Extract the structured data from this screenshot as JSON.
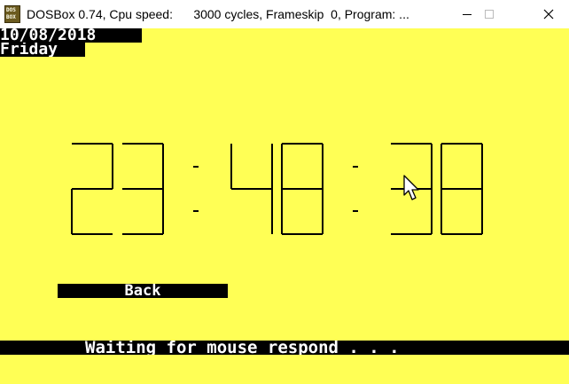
{
  "window": {
    "title": "DOSBox 0.74, Cpu speed:      3000 cycles, Frameskip  0, Program: ...",
    "icon_label_top": "DOS",
    "icon_label_bottom": "BOX"
  },
  "screen": {
    "date": "10/08/2018",
    "day": "Friday",
    "clock": {
      "hours": "23",
      "minutes": "48",
      "seconds": "38"
    },
    "back_label": "Back",
    "status": "Waiting for mouse respond . . ."
  },
  "colors": {
    "screen_bg": "#ffff55",
    "text_bg": "#000000",
    "text_fg": "#ffffff"
  },
  "icons": [
    "minimize-icon",
    "maximize-icon",
    "close-icon",
    "mouse-cursor-icon"
  ]
}
